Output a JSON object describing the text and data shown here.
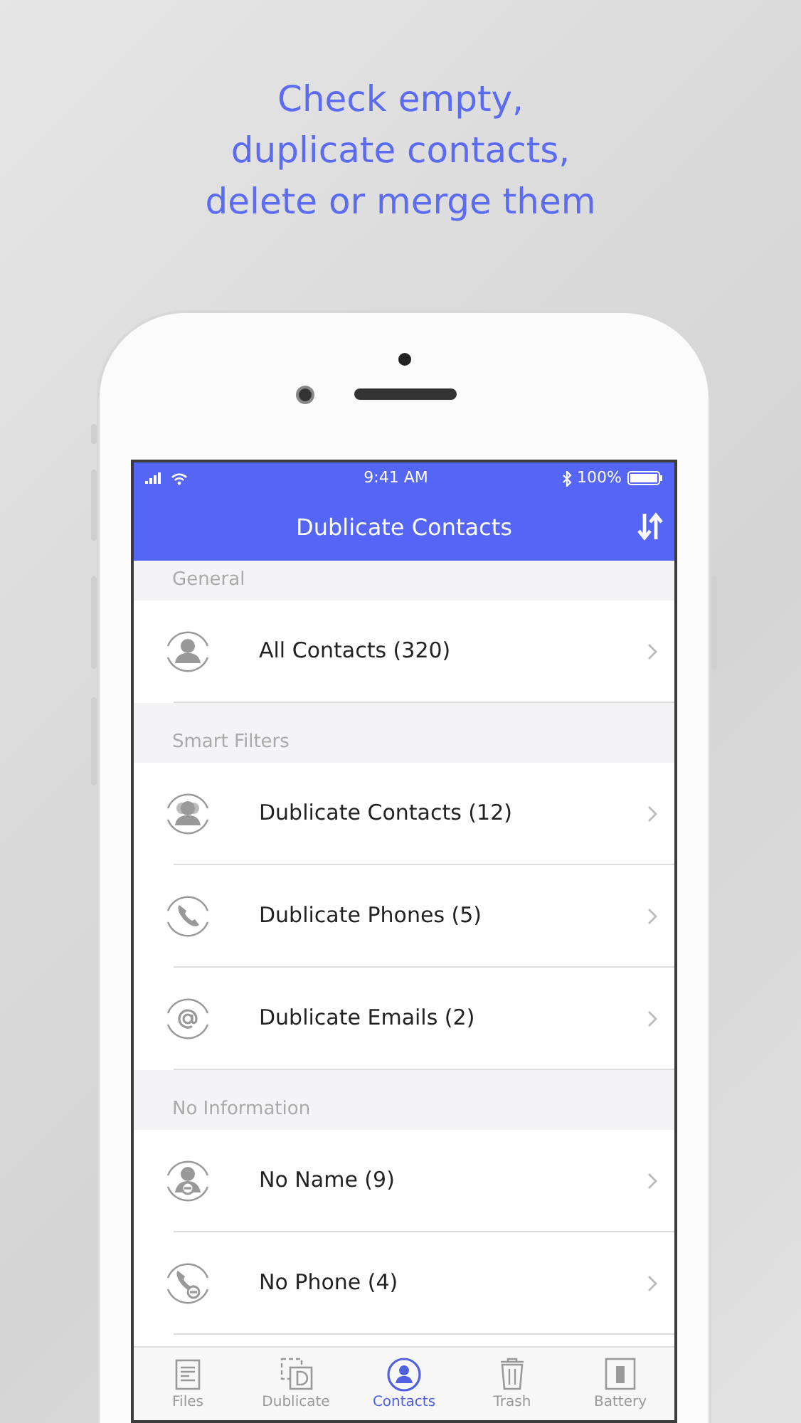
{
  "headline": [
    "Check empty,",
    "duplicate contacts,",
    "delete or merge them"
  ],
  "status_bar": {
    "time": "9:41 AM",
    "battery": "100%"
  },
  "nav": {
    "title": "Dublicate Contacts"
  },
  "sections": [
    {
      "title": "General",
      "rows": [
        {
          "kind": "person",
          "label": "All Contacts (320)"
        }
      ]
    },
    {
      "title": "Smart Filters",
      "rows": [
        {
          "kind": "people",
          "label": "Dublicate Contacts (12)"
        },
        {
          "kind": "phone",
          "label": "Dublicate Phones (5)"
        },
        {
          "kind": "email",
          "label": "Dublicate Emails (2)"
        }
      ]
    },
    {
      "title": "No Information",
      "rows": [
        {
          "kind": "noname",
          "label": "No Name (9)"
        },
        {
          "kind": "nophone",
          "label": "No Phone (4)"
        }
      ]
    }
  ],
  "tabs": [
    {
      "kind": "files",
      "label": "Files",
      "selected": false
    },
    {
      "kind": "duplicate",
      "label": "Dublicate",
      "selected": false
    },
    {
      "kind": "contacts",
      "label": "Contacts",
      "selected": true
    },
    {
      "kind": "trash",
      "label": "Trash",
      "selected": false
    },
    {
      "kind": "battery",
      "label": "Battery",
      "selected": false
    }
  ]
}
